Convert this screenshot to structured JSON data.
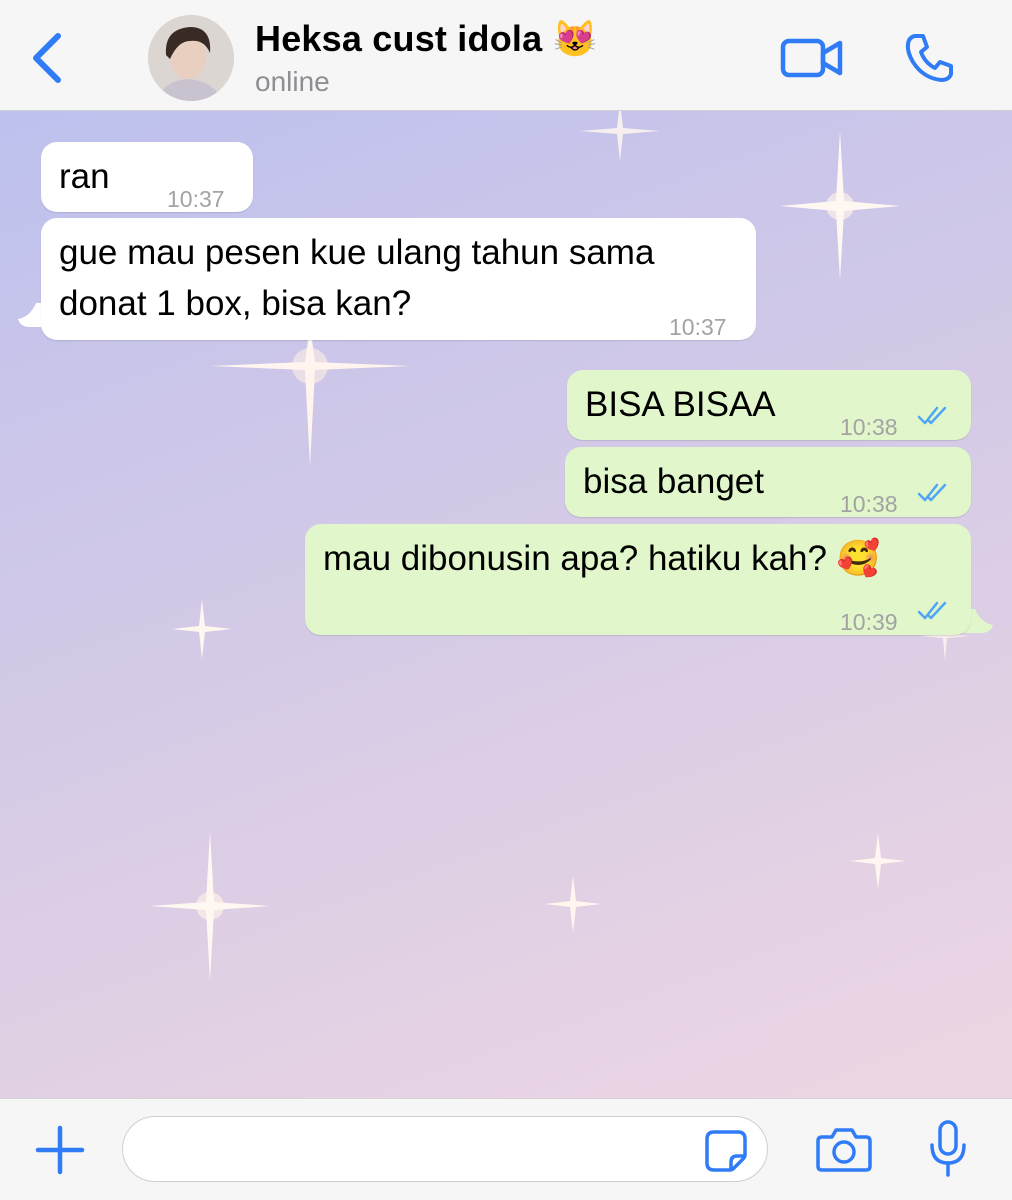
{
  "header": {
    "contact_name": "Heksa cust idola",
    "contact_name_emoji": "😻",
    "status": "online",
    "icons": [
      "chevron-left-icon",
      "video-camera-icon",
      "phone-icon"
    ],
    "accent_color": "#2f7cf6"
  },
  "messages": [
    {
      "direction": "incoming",
      "lines": [
        "ran"
      ],
      "time": "10:37"
    },
    {
      "direction": "incoming",
      "lines": [
        "gue mau pesen kue ulang tahun sama",
        "donat 1 box, bisa kan?"
      ],
      "time": "10:37"
    },
    {
      "direction": "outgoing",
      "lines": [
        "BISA BISAA"
      ],
      "time": "10:38",
      "read": true
    },
    {
      "direction": "outgoing",
      "lines": [
        "bisa banget"
      ],
      "time": "10:38",
      "read": true
    },
    {
      "direction": "outgoing",
      "lines": [
        "mau dibonusin apa? hatiku kah? 🥰"
      ],
      "time": "10:39",
      "read": true
    }
  ],
  "input": {
    "placeholder": "",
    "value": "",
    "icons": [
      "plus-icon",
      "sticker-icon",
      "camera-icon",
      "microphone-icon"
    ]
  },
  "colors": {
    "incoming_bubble": "#ffffff",
    "outgoing_bubble": "#e1f7cb",
    "read_ticks": "#4fa6f5",
    "timestamp": "#a3a3a3"
  }
}
